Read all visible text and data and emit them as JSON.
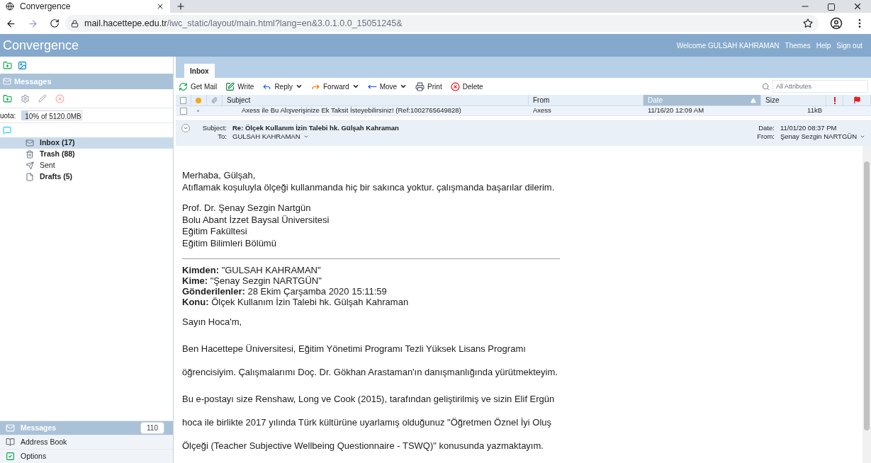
{
  "browser": {
    "tab_title": "Convergence",
    "url_host": "mail.hacettepe.edu.tr",
    "url_path": "/iwc_static/layout/main.html?lang=en&3.0.1.0.0_15051245&"
  },
  "app": {
    "title": "Convergence",
    "welcome": "Welcome GULSAH KAHRAMAN",
    "links": [
      "Themes",
      "Help",
      "Sign out"
    ]
  },
  "sidebar": {
    "section": "Messages",
    "quota": {
      "label": "uota:",
      "text": "10% of 5120.0MB",
      "level": 0.1
    },
    "folders": [
      {
        "name": "Inbox (17)",
        "kind": "inbox",
        "selected": true,
        "has_unread": true
      },
      {
        "name": "Trash (88)",
        "kind": "trash",
        "selected": false,
        "has_unread": true
      },
      {
        "name": "Sent",
        "kind": "sent",
        "selected": false,
        "has_unread": false
      },
      {
        "name": "Drafts (5)",
        "kind": "drafts",
        "selected": false,
        "has_unread": true
      }
    ],
    "nav": [
      {
        "label": "Messages",
        "kind": "messages",
        "selected": true,
        "badge": "110"
      },
      {
        "label": "Address Book",
        "kind": "contacts",
        "selected": false
      },
      {
        "label": "Options",
        "kind": "options",
        "selected": false
      }
    ]
  },
  "tabs": [
    {
      "label": "Inbox",
      "selected": true
    }
  ],
  "toolbar": [
    {
      "label": "Get Mail",
      "kind": "getmail",
      "menu": false
    },
    {
      "label": "Write",
      "kind": "write",
      "menu": false
    },
    {
      "label": "Reply",
      "kind": "reply",
      "menu": true
    },
    {
      "label": "Forward",
      "kind": "forward",
      "menu": true
    },
    {
      "label": "Move",
      "kind": "move",
      "menu": true
    },
    {
      "label": "Print",
      "kind": "print",
      "menu": false
    },
    {
      "label": "Delete",
      "kind": "delete",
      "menu": false
    }
  ],
  "search": {
    "placeholder": "All Attributes"
  },
  "table": {
    "columns": [
      {
        "kind": "check",
        "selected": false
      },
      {
        "kind": "priority",
        "selected": false
      },
      {
        "kind": "attachment",
        "selected": false
      },
      {
        "kind": "text",
        "label": "Subject",
        "selected": false
      },
      {
        "kind": "text",
        "label": "From",
        "selected": false
      },
      {
        "kind": "text",
        "label": "Date",
        "selected": true
      },
      {
        "kind": "text",
        "label": "Size",
        "selected": false
      },
      {
        "kind": "important",
        "selected": false
      },
      {
        "kind": "flag",
        "selected": false
      }
    ],
    "rows": [
      {
        "subject": "Axess ile Bu Alışverişinize Ek Taksit İsteyebilirsiniz! (Ref:1002765649828)",
        "from": "Axess",
        "date": "11/16/20 12:09 AM",
        "size": "11kB",
        "checked": false
      }
    ]
  },
  "preview": {
    "subject_label": "Subject:",
    "subject": "Re: Ölçek Kullanım İzin Talebi hk. Gülşah Kahraman",
    "to_label": "To:",
    "to": "GULSAH KAHRAMAN",
    "date_label": "Date:",
    "date": "11/01/20 08:37 PM",
    "from_label": "From:",
    "from": "Şenay Sezgin NARTGÜN",
    "greeting": [
      "Merhaba, Gülşah,",
      "Atıflamak koşuluyla ölçeği kullanmanda hiç bir sakınca yoktur. çalışmanda başarılar dilerim."
    ],
    "signature": [
      "Prof. Dr. Şenay Sezgin Nartgün",
      "Bolu Abant İzzet Baysal Üniversitesi",
      "Eğitim Fakültesi",
      "Eğitim Bilimleri Bölümü"
    ],
    "quoted_header": [
      {
        "label": "Kimden:",
        "value": "\"GULSAH KAHRAMAN\""
      },
      {
        "label": "Kime:",
        "value": "\"Şenay Sezgin NARTGÜN\""
      },
      {
        "label": "Gönderilenler:",
        "value": "28 Ekim Çarşamba 2020 15:11:59"
      },
      {
        "label": "Konu:",
        "value": "Ölçek Kullanım İzin Talebi hk. Gülşah Kahraman"
      }
    ],
    "quoted_body": [
      [
        "Sayın Hoca'm,"
      ],
      [
        "Ben Hacettepe Üniversitesi, Eğitim Yönetimi Programı Tezli Yüksek Lisans Programı",
        "öğrencisiyim. Çalışmalarımı Doç. Dr. Gökhan Arastaman'ın danışmanlığında yürütmekteyim."
      ],
      [
        "Bu e-postayı size Renshaw, Long ve Cook (2015), tarafından geliştirilmiş ve sizin Elif Ergün",
        "hoca ile birlikte 2017 yılında Türk kültürüne uyarlamış olduğunuz \"Öğretmen Öznel İyi Oluş",
        "Ölçeği (Teacher Subjective Wellbeing Questionnaire - TSWQ)\" konusunda yazmaktayım."
      ]
    ]
  }
}
